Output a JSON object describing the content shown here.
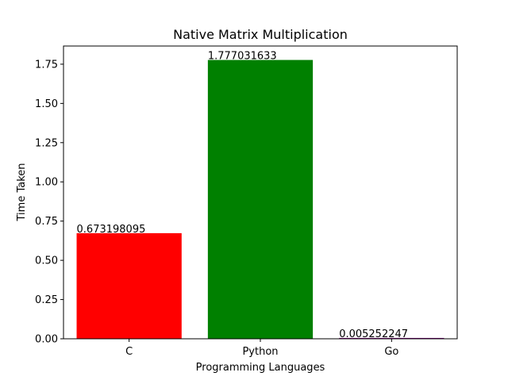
{
  "chart_data": {
    "type": "bar",
    "title": "Native Matrix Multiplication",
    "xlabel": "Programming Languages",
    "ylabel": "Time Taken",
    "categories": [
      "C",
      "Python",
      "Go"
    ],
    "values": [
      0.673198095,
      1.777031633,
      0.005252247
    ],
    "value_labels": [
      "0.673198095",
      "1.777031633",
      "0.005252247"
    ],
    "colors": [
      "#ff0000",
      "#008000",
      "#800080"
    ],
    "ylim": [
      0,
      1.865883
    ],
    "yticks": [
      0.0,
      0.25,
      0.5,
      0.75,
      1.0,
      1.25,
      1.5,
      1.75
    ],
    "ytick_labels": [
      "0.00",
      "0.25",
      "0.50",
      "0.75",
      "1.00",
      "1.25",
      "1.50",
      "1.75"
    ],
    "grid": false,
    "legend": "none"
  }
}
